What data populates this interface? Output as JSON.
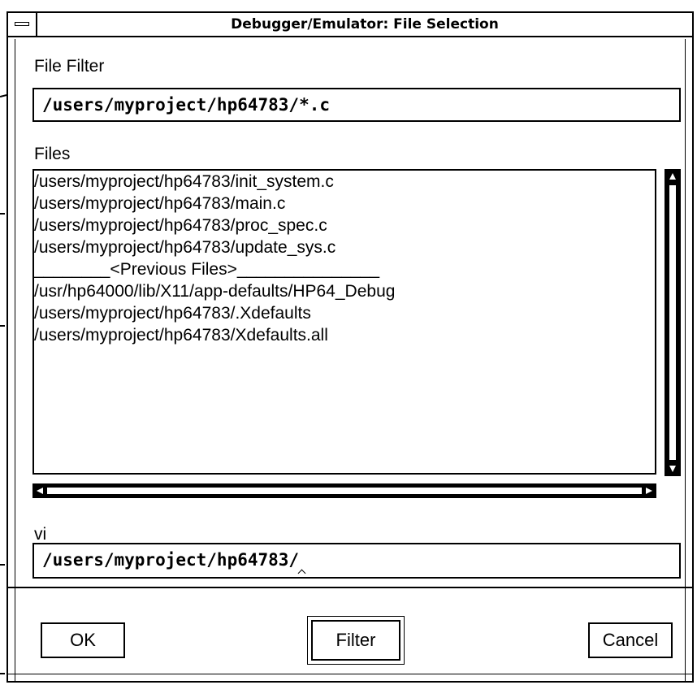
{
  "window": {
    "title": "Debugger/Emulator: File Selection"
  },
  "filter": {
    "label": "File Filter",
    "value": "/users/myproject/hp64783/*.c"
  },
  "files": {
    "label": "Files",
    "items": [
      "/users/myproject/hp64783/init_system.c",
      "/users/myproject/hp64783/main.c",
      "/users/myproject/hp64783/proc_spec.c",
      "/users/myproject/hp64783/update_sys.c",
      "________<Previous Files>_______________",
      "/usr/hp64000/lib/X11/app-defaults/HP64_Debug",
      "/users/myproject/hp64783/.Xdefaults",
      "/users/myproject/hp64783/Xdefaults.all"
    ]
  },
  "selection": {
    "label": "vi",
    "value": "/users/myproject/hp64783/"
  },
  "buttons": {
    "ok": "OK",
    "filter": "Filter",
    "cancel": "Cancel"
  }
}
